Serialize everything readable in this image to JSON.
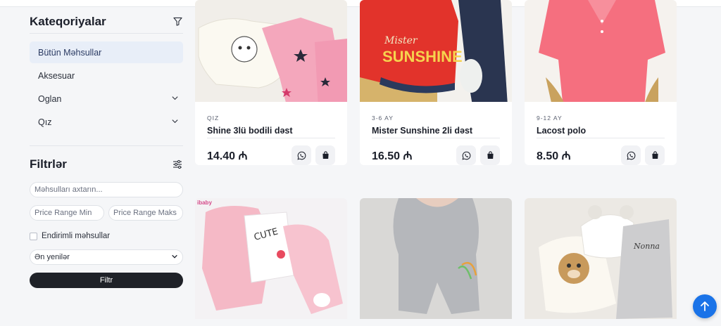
{
  "sidebar": {
    "categories_title": "Kateqoriyalar",
    "categories": [
      {
        "label": "Bütün Məhsullar",
        "active": true,
        "has_children": false
      },
      {
        "label": "Aksesuar",
        "active": false,
        "has_children": false
      },
      {
        "label": "Oglan",
        "active": false,
        "has_children": true
      },
      {
        "label": "Qız",
        "active": false,
        "has_children": true
      }
    ],
    "filters_title": "Filtrlər",
    "search_placeholder": "Məhsulları axtarın...",
    "price_min_placeholder": "Price Range Min",
    "price_max_placeholder": "Price Range Maks",
    "discount_label": "Endirimli məhsullar",
    "sort_selected": "Ən yenilər",
    "filter_button": "Filtr"
  },
  "products": [
    {
      "age": "QIZ",
      "name": "Shine 3lü bodili dəst",
      "price": "14.40 ₼"
    },
    {
      "age": "3-6 AY",
      "name": "Mister Sunshine 2li dəst",
      "price": "16.50 ₼"
    },
    {
      "age": "9-12 AY",
      "name": "Lacost polo",
      "price": "8.50 ₼"
    }
  ],
  "second_row": {
    "watermark": "ibaby",
    "embroidery": "Nonna"
  },
  "colors": {
    "accent": "#1a73e8",
    "dark_button": "#1f2228",
    "active_category_bg": "#e8eef8"
  },
  "icons": {
    "filter": "funnel-icon",
    "settings": "sliders-icon",
    "whatsapp": "whatsapp-icon",
    "cart": "shopping-bag-icon",
    "scroll_top": "arrow-up-icon"
  }
}
